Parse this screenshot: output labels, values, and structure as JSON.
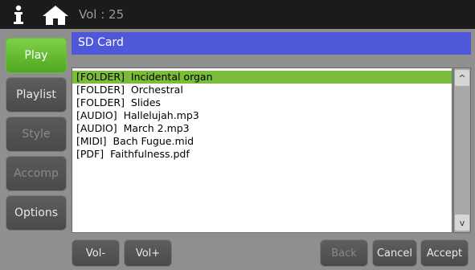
{
  "topbar": {
    "volume": "Vol : 25",
    "icons": [
      "info-icon",
      "home-icon"
    ]
  },
  "sidebar": {
    "items": [
      {
        "label": "Play",
        "state": "active"
      },
      {
        "label": "Playlist",
        "state": "normal"
      },
      {
        "label": "Style",
        "state": "disabled"
      },
      {
        "label": "Accomp",
        "state": "disabled"
      },
      {
        "label": "Options",
        "state": "normal"
      }
    ]
  },
  "header": {
    "title": "SD Card"
  },
  "files": [
    {
      "type": "[FOLDER]",
      "name": "Incidental organ",
      "selected": true
    },
    {
      "type": "[FOLDER]",
      "name": "Orchestral",
      "selected": false
    },
    {
      "type": "[FOLDER]",
      "name": "Slides",
      "selected": false
    },
    {
      "type": "[AUDIO]",
      "name": "Hallelujah.mp3",
      "selected": false
    },
    {
      "type": "[AUDIO]",
      "name": "March 2.mp3",
      "selected": false
    },
    {
      "type": "[MIDI]",
      "name": "Bach Fugue.mid",
      "selected": false
    },
    {
      "type": "[PDF]",
      "name": "Faithfulness.pdf",
      "selected": false
    }
  ],
  "scroll": {
    "up": "^",
    "down": "v"
  },
  "buttons": {
    "vol_minus": "Vol-",
    "vol_plus": "Vol+",
    "back": "Back",
    "cancel": "Cancel",
    "accept": "Accept"
  },
  "colors": {
    "accent_green": "#6cc23a",
    "header_blue": "#4f58d8",
    "selection_green": "#7bbd3a"
  }
}
